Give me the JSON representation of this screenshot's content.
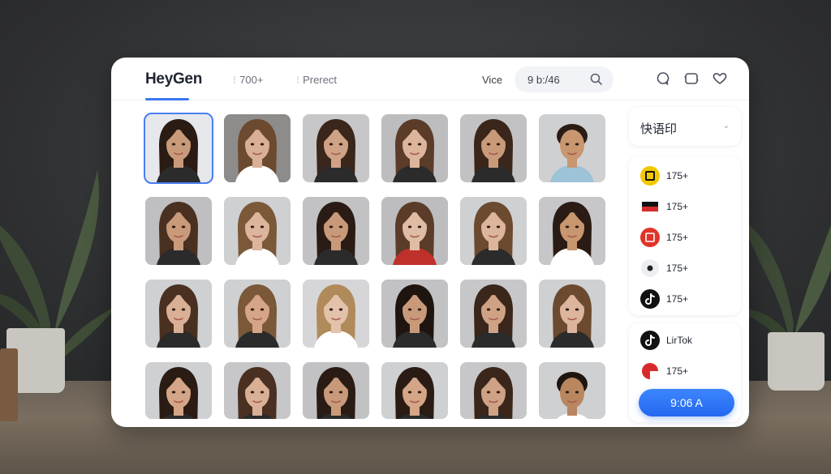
{
  "header": {
    "brand": "HeyGen",
    "count_label": "700+",
    "preset_label": "Prerect",
    "voice_label": "Vice",
    "search_value": "9 b:/46"
  },
  "icons": {
    "search": "search-icon",
    "chat": "chat-icon",
    "layers": "layers-icon",
    "heart": "heart-icon"
  },
  "language_select": {
    "value": "快语印"
  },
  "platform_list": [
    {
      "label": "175+",
      "icon": "yellow-box-icon",
      "color": "#f2c800"
    },
    {
      "label": "175+",
      "icon": "flag-icon",
      "color": "#d62b2b"
    },
    {
      "label": "175+",
      "icon": "red-square-icon",
      "color": "#e0342a"
    },
    {
      "label": "175+",
      "icon": "dot-icon",
      "color": "#222222"
    },
    {
      "label": "175+",
      "icon": "tiktok-icon",
      "color": "#111111"
    }
  ],
  "platform_list2": [
    {
      "label": "LirTok",
      "icon": "tiktok-icon",
      "color": "#111111"
    },
    {
      "label": "175+",
      "icon": "red-arc-icon",
      "color": "#d62b2b"
    }
  ],
  "time_button": "9:06 A",
  "colors": {
    "accent": "#2f74f5",
    "panel": "#ffffff",
    "text": "#1f2430"
  },
  "avatars": [
    {
      "hair": "#2a1c14",
      "skin": "#c99a7a",
      "shirt": "#2b2b2b",
      "bg": "#e6e8ec"
    },
    {
      "hair": "#6b4a30",
      "skin": "#d9b095",
      "shirt": "#ffffff",
      "bg": "#8e8c8a"
    },
    {
      "hair": "#3a261a",
      "skin": "#cfa285",
      "shirt": "#2b2b2b",
      "bg": "#c7c7c9"
    },
    {
      "hair": "#5a3c28",
      "skin": "#dcb59c",
      "shirt": "#2b2b2b",
      "bg": "#bdbdbf"
    },
    {
      "hair": "#3a261a",
      "skin": "#c99a7a",
      "shirt": "#2b2b2b",
      "bg": "#c2c2c4"
    },
    {
      "hair": "#2a1c14",
      "skin": "#c8966f",
      "shirt": "#9cc3d8",
      "bg": "#cfd0d2"
    },
    {
      "hair": "#4a3020",
      "skin": "#c99a7a",
      "shirt": "#2b2b2b",
      "bg": "#bfbfc1"
    },
    {
      "hair": "#7a5838",
      "skin": "#dcb59c",
      "shirt": "#ffffff",
      "bg": "#cfd0d2"
    },
    {
      "hair": "#2a1c14",
      "skin": "#c99a7a",
      "shirt": "#2b2b2b",
      "bg": "#c2c2c4"
    },
    {
      "hair": "#5a3c28",
      "skin": "#e0bca5",
      "shirt": "#c0302a",
      "bg": "#bdbdbf"
    },
    {
      "hair": "#6b4a30",
      "skin": "#dcb59c",
      "shirt": "#2b2b2b",
      "bg": "#cfd0d2"
    },
    {
      "hair": "#2a1c14",
      "skin": "#c8966f",
      "shirt": "#ffffff",
      "bg": "#c7c7c9"
    },
    {
      "hair": "#4a3020",
      "skin": "#d9b095",
      "shirt": "#2b2b2b",
      "bg": "#cfd0d2"
    },
    {
      "hair": "#7a5838",
      "skin": "#d4a586",
      "shirt": "#2b2b2b",
      "bg": "#cfd0d2"
    },
    {
      "hair": "#b08a5a",
      "skin": "#e3c2ab",
      "shirt": "#ffffff",
      "bg": "#d6d6d8"
    },
    {
      "hair": "#1f1510",
      "skin": "#c99a7a",
      "shirt": "#2b2b2b",
      "bg": "#c2c2c4"
    },
    {
      "hair": "#3a261a",
      "skin": "#cfa285",
      "shirt": "#2b2b2b",
      "bg": "#c7c7c9"
    },
    {
      "hair": "#6b4a30",
      "skin": "#dcb59c",
      "shirt": "#2b2b2b",
      "bg": "#cfd0d2"
    },
    {
      "hair": "#2a1c14",
      "skin": "#d4a586",
      "shirt": "#2b2b2b",
      "bg": "#cfd0d2"
    },
    {
      "hair": "#4a3020",
      "skin": "#d9b095",
      "shirt": "#2b2b2b",
      "bg": "#c7c7c9"
    },
    {
      "hair": "#2a1c14",
      "skin": "#c99a7a",
      "shirt": "#2b2b2b",
      "bg": "#c2c2c4"
    },
    {
      "hair": "#2a1c14",
      "skin": "#d4a586",
      "shirt": "#2b2b2b",
      "bg": "#cfd0d2"
    },
    {
      "hair": "#3a261a",
      "skin": "#cfa285",
      "shirt": "#2b2b2b",
      "bg": "#c7c7c9"
    },
    {
      "hair": "#1f1510",
      "skin": "#b98660",
      "shirt": "#ffffff",
      "bg": "#cfd0d2"
    }
  ]
}
